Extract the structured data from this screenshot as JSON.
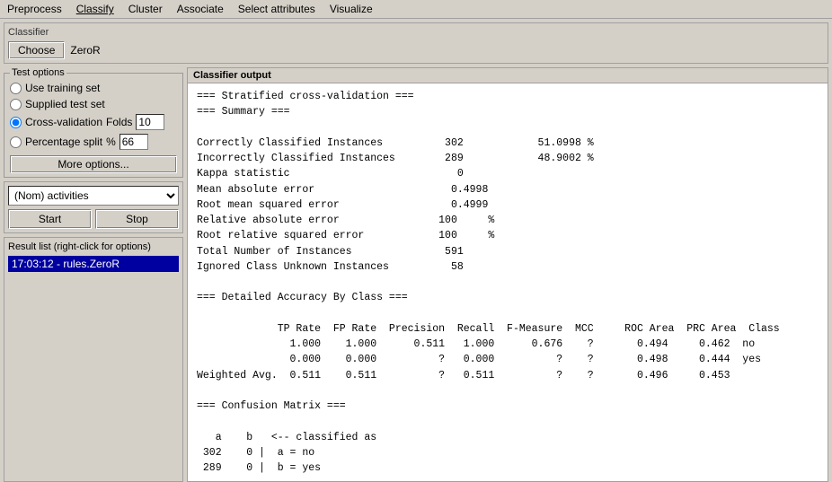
{
  "menu": {
    "items": [
      "Preprocess",
      "Classify",
      "Cluster",
      "Associate",
      "Select attributes",
      "Visualize"
    ]
  },
  "classifier_section": {
    "title": "Classifier",
    "choose_label": "Choose",
    "classifier_name": "ZeroR"
  },
  "test_options": {
    "title": "Test options",
    "options": [
      {
        "label": "Use training set",
        "id": "use-training"
      },
      {
        "label": "Supplied test set",
        "id": "supplied"
      },
      {
        "label": "Cross-validation",
        "id": "cross-validation"
      },
      {
        "label": "Percentage split",
        "id": "pct-split"
      }
    ],
    "folds_label": "Folds",
    "folds_value": "10",
    "pct_label": "%",
    "pct_value": "66",
    "more_options_label": "More options..."
  },
  "activities": {
    "title": "(Nom) activities",
    "placeholder": "(Nom) activities"
  },
  "buttons": {
    "start_label": "Start",
    "stop_label": "Stop"
  },
  "result_list": {
    "title": "Result list (right-click for options)",
    "items": [
      "17:03:12 - rules.ZeroR"
    ]
  },
  "output": {
    "title": "Classifier output",
    "content": "=== Stratified cross-validation ===\n=== Summary ===\n\nCorrectly Classified Instances          302            51.0998 %\nIncorrectly Classified Instances        289            48.9002 %\nKappa statistic                           0\nMean absolute error                      0.4998\nRoot mean squared error                  0.4999\nRelative absolute error                100     %\nRoot relative squared error            100     %\nTotal Number of Instances               591\nIgnored Class Unknown Instances          58\n\n=== Detailed Accuracy By Class ===\n\n             TP Rate  FP Rate  Precision  Recall  F-Measure  MCC     ROC Area  PRC Area  Class\n               1.000    1.000      0.511   1.000      0.676    ?       0.494     0.462  no\n               0.000    0.000          ?   0.000          ?    ?       0.498     0.444  yes\nWeighted Avg.  0.511    0.511          ?   0.511          ?    ?       0.496     0.453\n\n=== Confusion Matrix ===\n\n   a    b   <-- classified as\n 302    0 |  a = no\n 289    0 |  b = yes"
  }
}
